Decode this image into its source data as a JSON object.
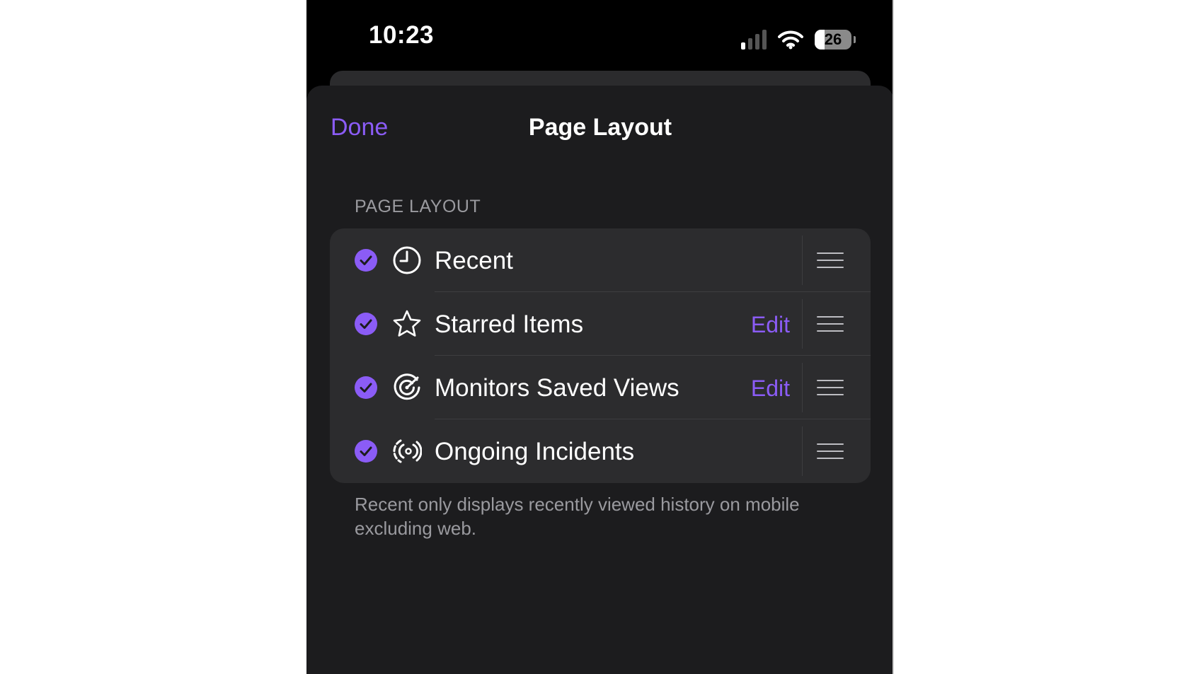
{
  "status_bar": {
    "time": "10:23",
    "battery_level": "26",
    "signal_bars_active": 1,
    "signal_bars_total": 4
  },
  "nav": {
    "done_label": "Done",
    "title": "Page Layout"
  },
  "section": {
    "header": "PAGE LAYOUT",
    "footer": "Recent only displays recently viewed history on mobile excluding web."
  },
  "items": [
    {
      "label": "Recent",
      "icon": "clock-icon",
      "checked": true,
      "edit": ""
    },
    {
      "label": "Starred Items",
      "icon": "star-icon",
      "checked": true,
      "edit": "Edit"
    },
    {
      "label": "Monitors Saved Views",
      "icon": "target-icon",
      "checked": true,
      "edit": "Edit"
    },
    {
      "label": "Ongoing Incidents",
      "icon": "broadcast-icon",
      "checked": true,
      "edit": ""
    }
  ],
  "colors": {
    "accent": "#8b5cf6",
    "sheet_background": "#1c1c1e",
    "group_background": "#2c2c2e",
    "secondary_text": "#9a9a9f"
  }
}
